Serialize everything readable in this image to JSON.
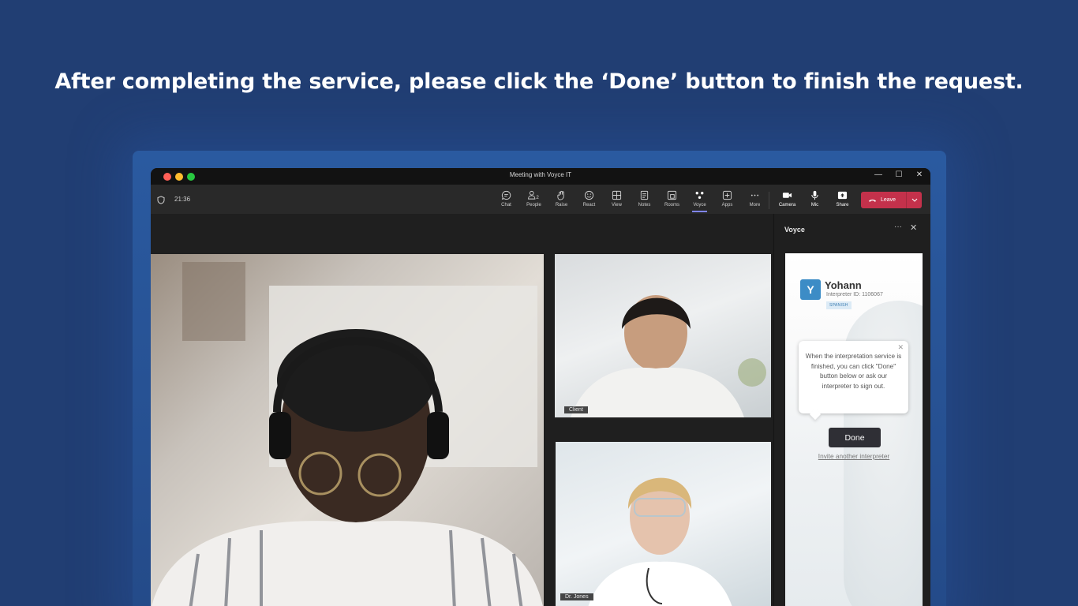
{
  "headline": "After completing the service, please click the ‘Done’ button to finish the request.",
  "window": {
    "title": "Meeting with Voyce IT",
    "controls": [
      "—",
      "☐",
      "✕"
    ]
  },
  "toolbar": {
    "time": "21:36",
    "items": [
      {
        "icon": "chat-icon",
        "label": "Chat"
      },
      {
        "icon": "people-icon",
        "label": "People",
        "count": "2"
      },
      {
        "icon": "raise-hand-icon",
        "label": "Raise"
      },
      {
        "icon": "react-icon",
        "label": "React"
      },
      {
        "icon": "view-icon",
        "label": "View"
      },
      {
        "icon": "notes-icon",
        "label": "Notes"
      },
      {
        "icon": "rooms-icon",
        "label": "Rooms"
      },
      {
        "icon": "voyce-icon",
        "label": "Voyce",
        "active": true
      },
      {
        "icon": "apps-icon",
        "label": "Apps"
      },
      {
        "icon": "more-icon",
        "label": "More"
      }
    ],
    "media": [
      {
        "icon": "camera-icon",
        "label": "Camera"
      },
      {
        "icon": "mic-icon",
        "label": "Mic"
      },
      {
        "icon": "share-icon",
        "label": "Share"
      }
    ],
    "leave_label": "Leave"
  },
  "participants": {
    "client_label": "Client",
    "doctor_label": "Dr. Jones"
  },
  "panel": {
    "title": "Voyce",
    "interpreter": {
      "initial": "Y",
      "name": "Yohann",
      "id_text": "Interpreter ID: 1106067",
      "language": "SPANISH"
    },
    "tooltip": "When the interpretation service is finished, you can click \"Done\" button below or ask our interpreter to sign out.",
    "done_label": "Done",
    "invite_label": "Invite another interpreter"
  },
  "colors": {
    "background": "#213e73",
    "leave": "#c4314b",
    "accent": "#7f85f5",
    "avatar": "#3c8cc6"
  }
}
